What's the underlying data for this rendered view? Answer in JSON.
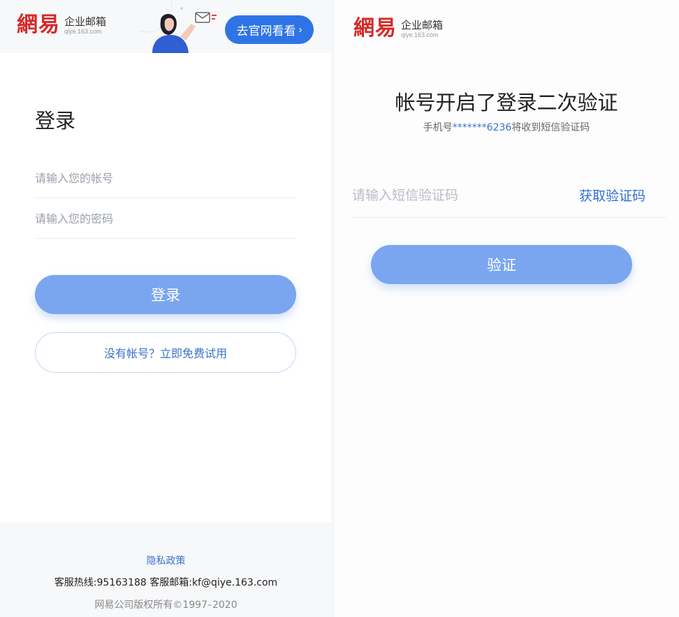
{
  "logo": {
    "mark": "網易",
    "name": "企业邮箱",
    "domain": "qiye.163.com"
  },
  "left": {
    "visit_button": "去官网看看",
    "visit_chevron": "›",
    "title": "登录",
    "account_placeholder": "请输入您的帐号",
    "password_placeholder": "请输入您的密码",
    "login_button": "登录",
    "trial_button": "没有帐号？立即免费试用",
    "footer": {
      "privacy": "隐私政策",
      "contact": "客服热线:95163188 客服邮箱:kf@qiye.163.com",
      "copyright": "网易公司版权所有©1997–2020"
    }
  },
  "right": {
    "title": "帐号开启了登录二次验证",
    "hint_prefix": "手机号",
    "hint_phone": "*******6236",
    "hint_suffix": "将收到短信验证码",
    "sms_placeholder": "请输入短信验证码",
    "get_code_button": "获取验证码",
    "verify_button": "验证"
  },
  "colors": {
    "brand_red": "#d42a27",
    "accent_blue": "#2f74e6",
    "button_blue": "#7aa6ef",
    "link_blue": "#3a72cc"
  },
  "icons": [
    "mail-icon",
    "chevron-right-icon"
  ]
}
